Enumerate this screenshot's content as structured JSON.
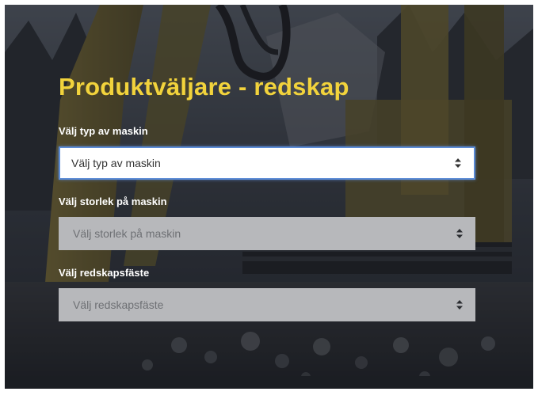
{
  "page": {
    "title": "Produktväljare - redskap"
  },
  "fields": [
    {
      "label": "Välj typ av maskin",
      "value": "Välj typ av maskin",
      "state": "active"
    },
    {
      "label": "Välj storlek på maskin",
      "value": "Välj storlek på maskin",
      "state": "disabled"
    },
    {
      "label": "Välj redskapsfäste",
      "value": "Välj redskapsfäste",
      "state": "disabled"
    }
  ],
  "colors": {
    "title": "#f2d33c",
    "active_border": "#5b8bd6",
    "disabled_background": "#b7b8bb"
  },
  "icons": {
    "select_arrows": "up-down-caret-icon"
  }
}
